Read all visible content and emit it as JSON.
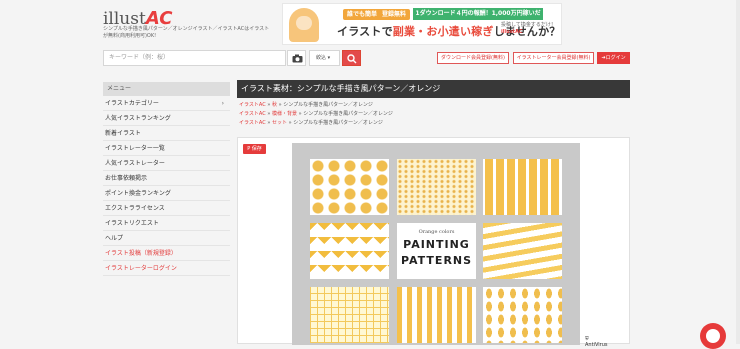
{
  "header": {
    "logo_text": "illust",
    "logo_accent": "AC",
    "tagline": "シンプルな手描き風パターン／オレンジイラスト／イラストACはイラスト",
    "tagline2": "が無料(商用利用可)OK!",
    "search_placeholder": "キーワード（例：桜）",
    "select_value": "絞込",
    "download_btn": "ダウンロード会員登録(無料)",
    "creator_btn": "イラストレーター会員登録(無料)",
    "login_btn": "ログイン"
  },
  "banner": {
    "pill1": "誰でも簡単",
    "pill2": "登録無料",
    "dl_text": "1ダウンロード４円の報酬！1,000万円稼いだ人も!",
    "headline_a": "イラストで",
    "headline_b": "副業・お小遣い稼ぎ",
    "headline_c": "しませんか？",
    "side1": "投稿して換金するだけ！",
    "side2": "illustAC"
  },
  "sidebar": {
    "heading": "メニュー",
    "items": [
      {
        "label": "イラストカテゴリー",
        "red": false,
        "arrow": true
      },
      {
        "label": "人気イラストランキング",
        "red": false
      },
      {
        "label": "新着イラスト",
        "red": false
      },
      {
        "label": "イラストレーター一覧",
        "red": false
      },
      {
        "label": "人気イラストレーター",
        "red": false
      },
      {
        "label": "お仕事依頼掲示",
        "red": false
      },
      {
        "label": "ポイント換金ランキング",
        "red": false
      },
      {
        "label": "エクストラライセンス",
        "red": false
      },
      {
        "label": "イラストリクエスト",
        "red": false
      },
      {
        "label": "ヘルプ",
        "red": false
      },
      {
        "label": "イラスト投稿（新規登録）",
        "red": true
      },
      {
        "label": "イラストレーターログイン",
        "red": true
      }
    ]
  },
  "main": {
    "title": "イラスト素材：シンプルな手描き風パターン／オレンジ",
    "crumbs": [
      {
        "links": [
          "イラストAC",
          "秋"
        ],
        "tail": "シンプルな手描き風パターン／オレンジ"
      },
      {
        "links": [
          "イラストAC",
          "模様・背景"
        ],
        "tail": "シンプルな手描き風パターン／オレンジ"
      },
      {
        "links": [
          "イラストAC",
          "セット"
        ],
        "tail": "シンプルな手描き風パターン／オレンジ"
      }
    ],
    "save_label": "保存",
    "art": {
      "subtitle": "Orange colors",
      "line1": "PAINTING",
      "line2": "PATTERNS",
      "badge": "AntiVirus"
    }
  },
  "colors": {
    "accent": "#e53b3b",
    "orange": "#f2bd3e"
  }
}
